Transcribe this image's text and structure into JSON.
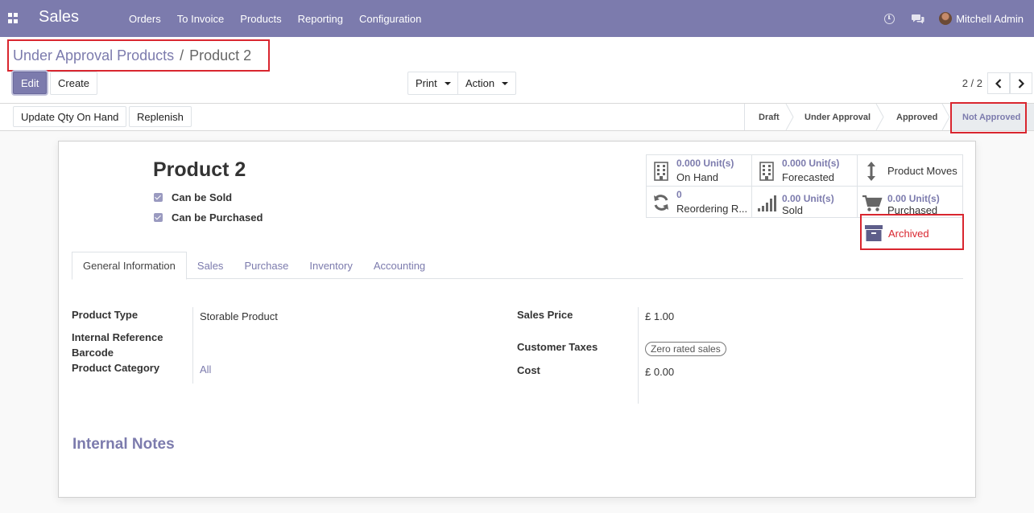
{
  "navbar": {
    "app_name": "Sales",
    "menu": [
      "Orders",
      "To Invoice",
      "Products",
      "Reporting",
      "Configuration"
    ],
    "user": "Mitchell Admin"
  },
  "breadcrumb": {
    "parent": "Under Approval Products",
    "separator": "/",
    "current": "Product 2"
  },
  "buttons": {
    "edit": "Edit",
    "create": "Create",
    "print": "Print",
    "action": "Action"
  },
  "pager": {
    "value": "2 / 2"
  },
  "header_buttons": {
    "update_qty": "Update Qty On Hand",
    "replenish": "Replenish"
  },
  "stages": [
    "Draft",
    "Under Approval",
    "Approved",
    "Not Approved"
  ],
  "active_stage": "Not Approved",
  "product": {
    "name": "Product 2",
    "can_be_sold_label": "Can be Sold",
    "can_be_purchased_label": "Can be Purchased"
  },
  "smart_buttons": {
    "on_hand": {
      "value": "0.000",
      "unit": "Unit(s)",
      "label": "On Hand"
    },
    "forecasted": {
      "value": "0.000",
      "unit": "Unit(s)",
      "label": "Forecasted"
    },
    "product_moves": {
      "label": "Product Moves"
    },
    "reordering": {
      "value": "0",
      "label": "Reordering R..."
    },
    "sold": {
      "value": "0.00",
      "unit": "Unit(s)",
      "label": "Sold"
    },
    "purchased": {
      "value": "0.00",
      "unit": "Unit(s)",
      "label": "Purchased"
    },
    "archived": {
      "label": "Archived"
    }
  },
  "tabs": [
    "General Information",
    "Sales",
    "Purchase",
    "Inventory",
    "Accounting"
  ],
  "fields": {
    "product_type_label": "Product Type",
    "product_type": "Storable Product",
    "internal_ref_label": "Internal Reference",
    "barcode_label": "Barcode",
    "category_label": "Product Category",
    "category": "All",
    "sales_price_label": "Sales Price",
    "sales_price": "£ 1.00",
    "customer_taxes_label": "Customer Taxes",
    "customer_taxes": "Zero rated sales",
    "cost_label": "Cost",
    "cost": "£ 0.00"
  },
  "notes_title": "Internal Notes",
  "colors": {
    "brand": "#7c7bad",
    "highlight": "#d9262f",
    "archived": "#d9262f"
  }
}
